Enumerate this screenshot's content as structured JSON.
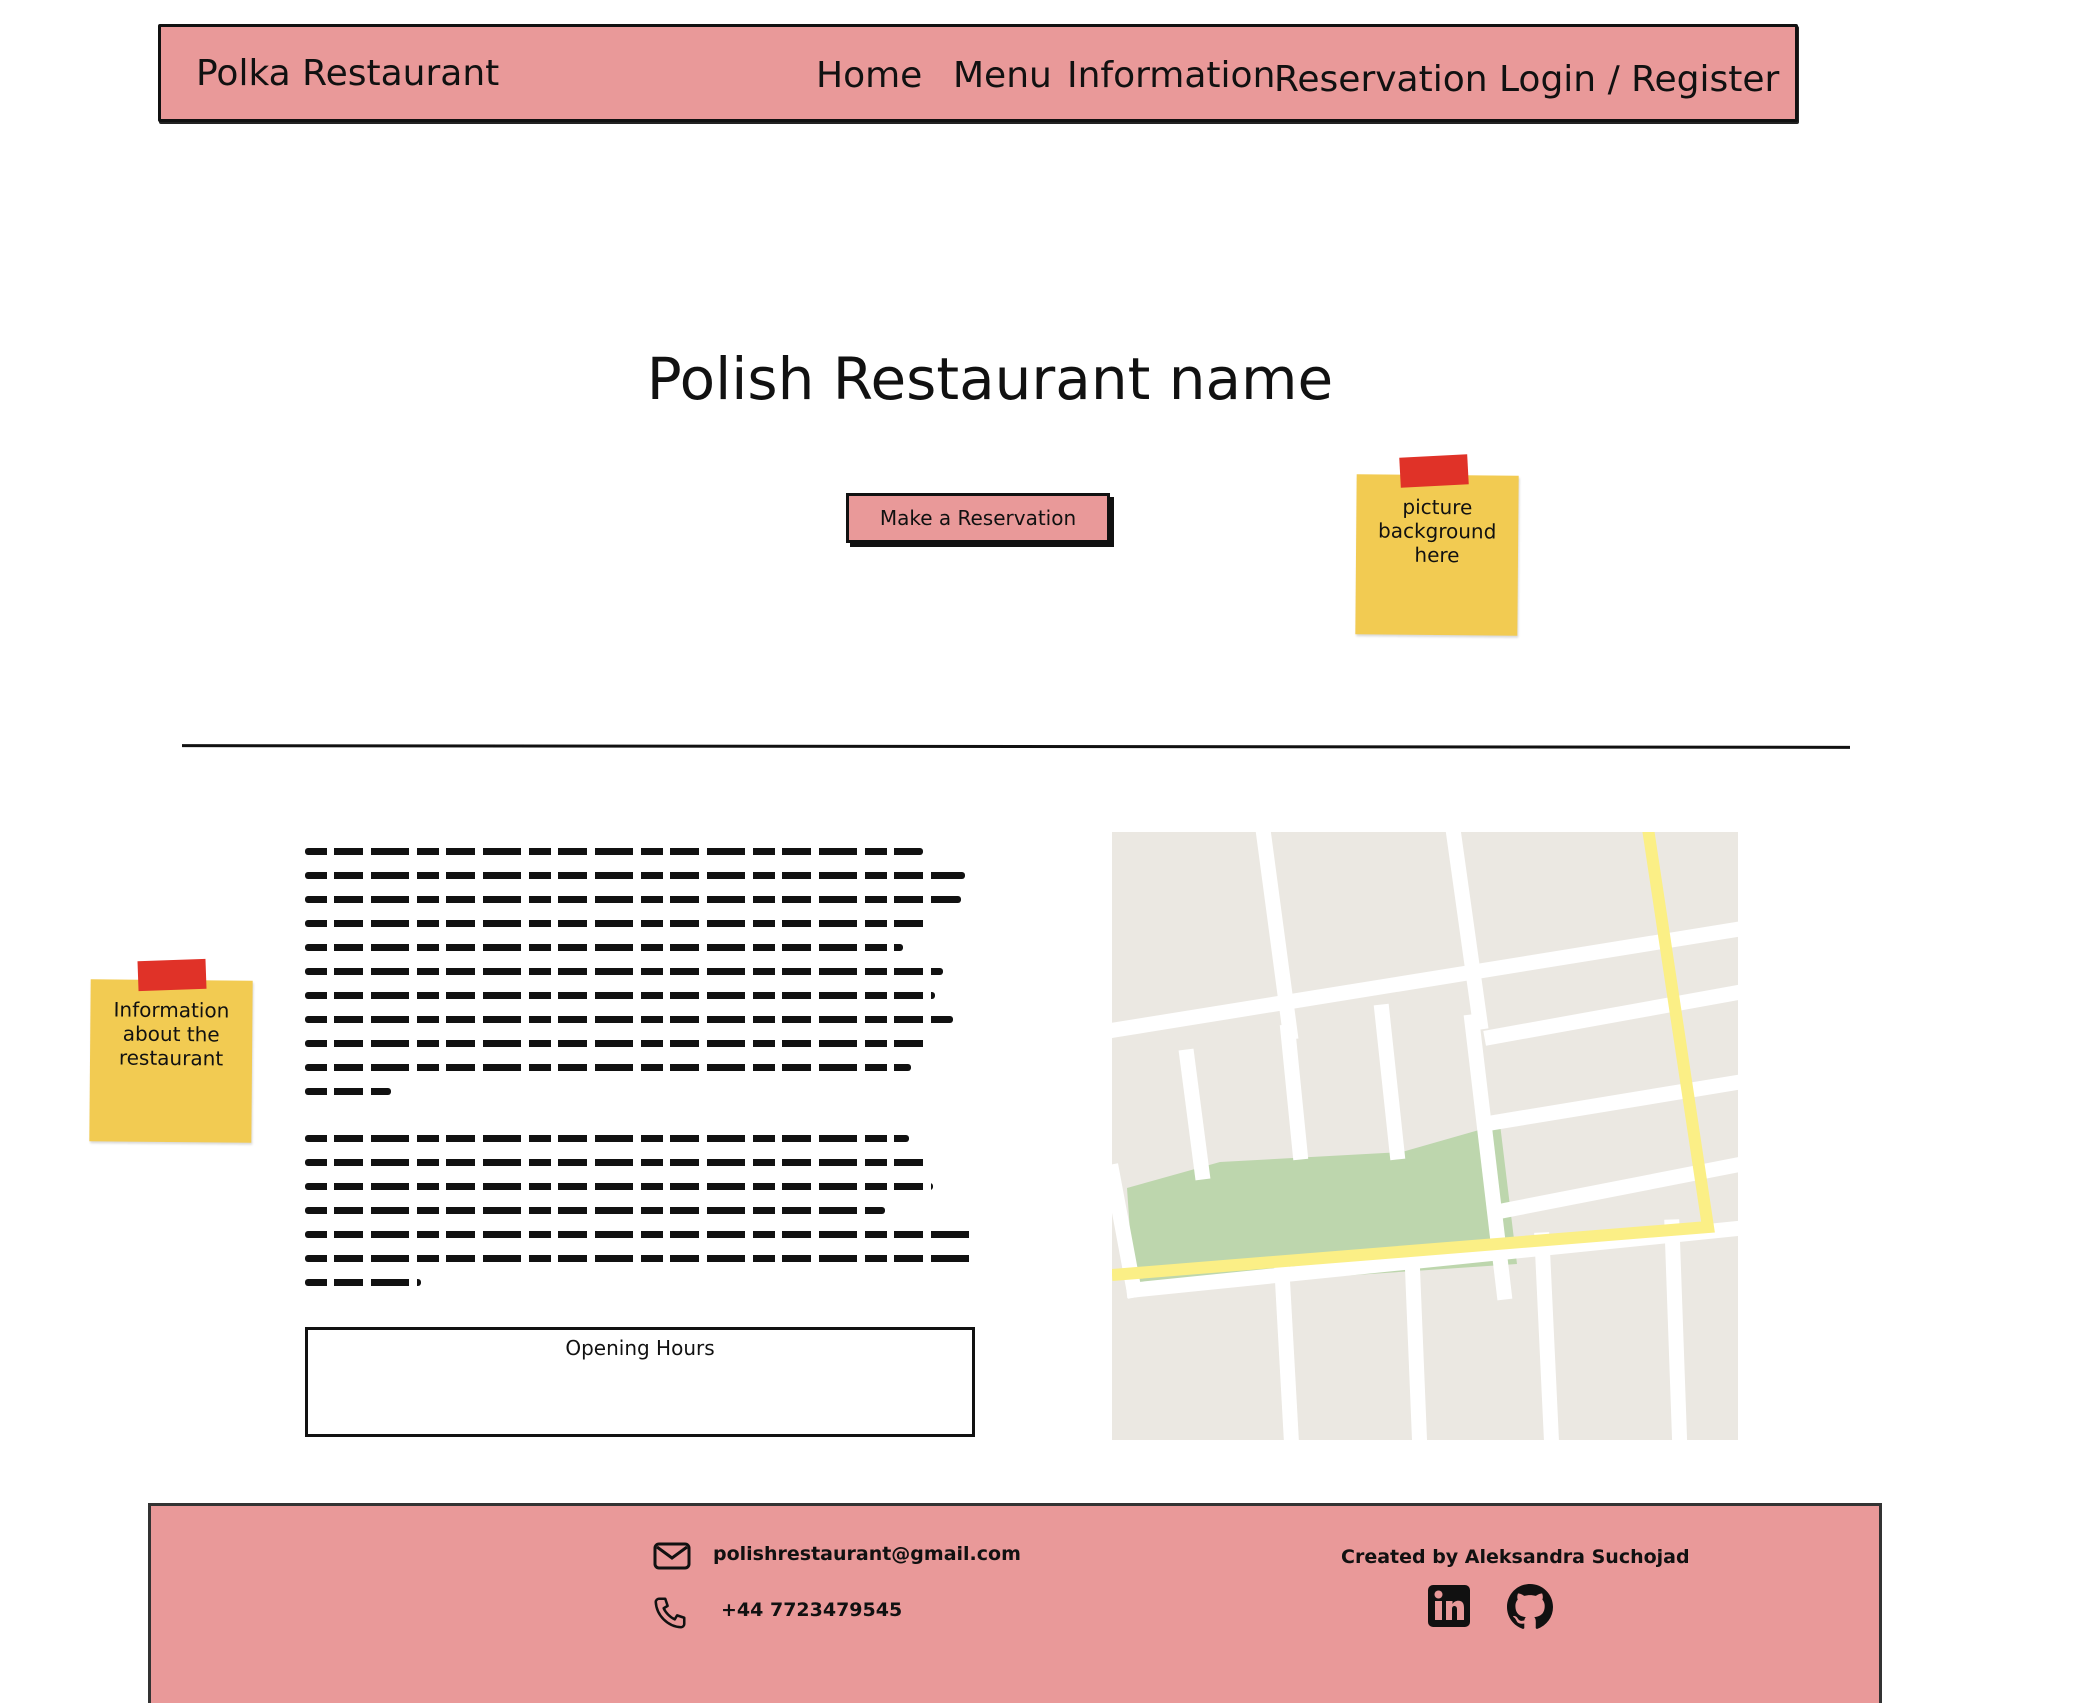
{
  "header": {
    "brand": "Polka Restaurant",
    "nav": [
      "Home",
      "Menu",
      "Information",
      "Reservation",
      "Login / Register"
    ]
  },
  "hero": {
    "title": "Polish Restaurant name",
    "cta": "Make a Reservation"
  },
  "notes": {
    "picture": [
      "picture",
      "background",
      "here"
    ],
    "info": [
      "Information",
      "about the",
      "restaurant"
    ]
  },
  "content": {
    "opening_hours_label": "Opening Hours"
  },
  "footer": {
    "email": "polishrestaurant@gmail.com",
    "phone": "+44 7723479545",
    "credit": "Created by Aleksandra Suchojad",
    "social_icons": [
      "linkedin-icon",
      "github-icon"
    ]
  },
  "colors": {
    "accent": "#e99999",
    "sticky": "#f2cb52",
    "tape": "#e03228",
    "map_park": "#bdd6ad",
    "map_road_highlight": "#fbef86",
    "map_ground": "#ebe8e2"
  }
}
